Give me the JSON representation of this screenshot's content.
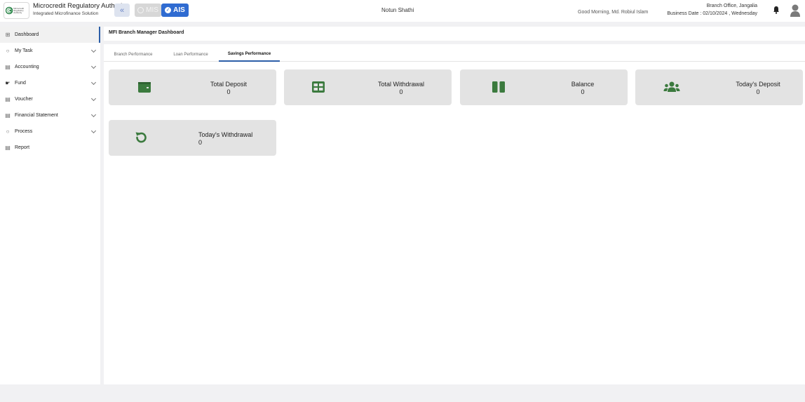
{
  "header": {
    "logo_mini_text": "Microcredit Regulatory Authority",
    "brand_title": "Microcredit Regulatory Authority",
    "brand_subtitle": "Integrated Microfinance Solution",
    "collapse_icon": "double-chevron-left-icon",
    "mis_label": "MIS",
    "ais_label": "AIS",
    "center_title": "Notun Shathi",
    "greeting": "Good Morning, Md. Robiul Islam",
    "branch": "Branch Office, Jangalia",
    "business_date": "Business Date : 02/10/2024 , Wednesday",
    "accent": "#2f6bd1"
  },
  "sidebar": {
    "items": [
      {
        "label": "Dashboard",
        "icon": "grid-icon",
        "active": true
      },
      {
        "label": "My Task",
        "icon": "circle-icon",
        "expandable": true
      },
      {
        "label": "Accounting",
        "icon": "ledger-icon",
        "expandable": true
      },
      {
        "label": "Fund",
        "icon": "money-hand-icon",
        "expandable": true
      },
      {
        "label": "Voucher",
        "icon": "ledger-icon",
        "expandable": true
      },
      {
        "label": "Financial Statement",
        "icon": "ledger-icon",
        "expandable": true
      },
      {
        "label": "Process",
        "icon": "circle-icon",
        "expandable": true
      },
      {
        "label": "Report",
        "icon": "ledger-icon"
      }
    ]
  },
  "main": {
    "page_title": "MFI Branch Manager Dashboard",
    "tabs": [
      {
        "label": "Branch Performance"
      },
      {
        "label": "Loan Performance"
      },
      {
        "label": "Savings Performance",
        "active": true
      }
    ],
    "cards": [
      {
        "label": "Total Deposit",
        "value": "0",
        "icon": "wallet-icon"
      },
      {
        "label": "Total Withdrawal",
        "value": "0",
        "icon": "table-icon"
      },
      {
        "label": "Balance",
        "value": "0",
        "icon": "columns-icon"
      },
      {
        "label": "Today's Deposit",
        "value": "0",
        "icon": "users-icon"
      },
      {
        "label": "Today's Withdrawal",
        "value": "0",
        "icon": "undo-icon"
      }
    ],
    "card_icon_color": "#3b7a3e"
  }
}
